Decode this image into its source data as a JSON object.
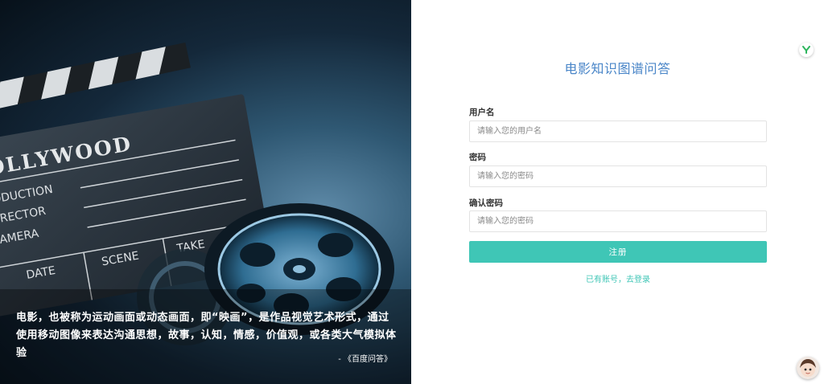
{
  "hero": {
    "quote": "电影，也被称为运动画面或动态画面，即“映画”，是作品视觉艺术形式，通过使用移动图像来表达沟通思想，故事，认知，情感，价值观，或各类大气模拟体验",
    "source": "- 《百度问答》",
    "slate": {
      "studio": "HOLLYWOOD",
      "rows": [
        "PRODUCTION",
        "DIRECTOR",
        "CAMERA"
      ],
      "bottom": [
        "DATE",
        "SCENE",
        "TAKE"
      ]
    }
  },
  "form": {
    "title": "电影知识图谱问答",
    "username": {
      "label": "用户名",
      "placeholder": "请输入您的用户名",
      "value": ""
    },
    "password": {
      "label": "密码",
      "placeholder": "请输入您的密码",
      "value": ""
    },
    "confirm": {
      "label": "确认密码",
      "placeholder": "请输入您的密码",
      "value": ""
    },
    "submit_label": "注册",
    "login_link": "已有账号，去登录"
  },
  "icons": {
    "extension": "y-logo-icon",
    "assistant": "avatar-icon"
  },
  "colors": {
    "accent": "#3fc6b6",
    "title": "#4a86c8"
  }
}
